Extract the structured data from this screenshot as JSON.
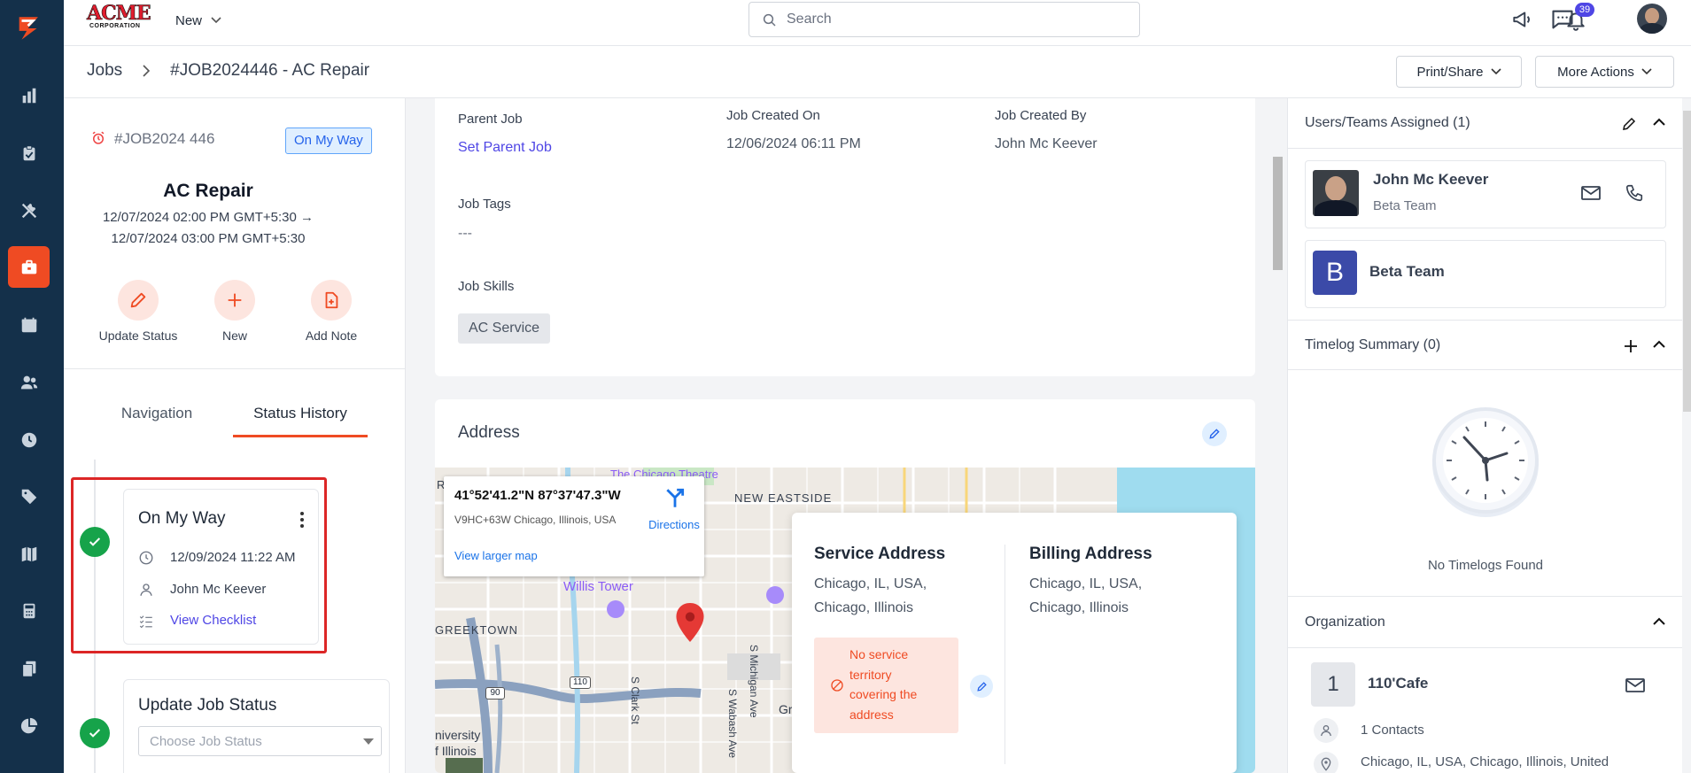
{
  "brand": {
    "logo_text": "ACME",
    "logo_sub": "CORPORATION",
    "accent": "#ef4b23",
    "rail_color": "#14304a"
  },
  "topbar": {
    "new_label": "New",
    "search_placeholder": "Search",
    "notification_count": "39"
  },
  "breadcrumb": {
    "root": "Jobs",
    "current": "#JOB2024446 - AC Repair"
  },
  "header_actions": {
    "print_share": "Print/Share",
    "more_actions": "More Actions"
  },
  "rail": [
    "logo-icon",
    "reports-icon",
    "clipboard-icon",
    "tools-icon",
    "jobs-icon",
    "calendar-icon",
    "users-icon",
    "clock-icon",
    "tag-icon",
    "map-icon",
    "calculator-icon",
    "documents-icon",
    "pie-chart-icon"
  ],
  "job": {
    "id": "#JOB2024 446",
    "status": "On My Way",
    "title": "AC Repair",
    "schedule_line1": "12/07/2024 02:00 PM GMT+5:30 →",
    "schedule_line2": "12/07/2024 03:00 PM GMT+5:30",
    "actions": [
      "Update Status",
      "New",
      "Add Note"
    ]
  },
  "left_tabs": {
    "navigation": "Navigation",
    "status_history": "Status History"
  },
  "history": {
    "status": "On My Way",
    "time": "12/09/2024 11:22 AM",
    "user": "John Mc Keever",
    "checklist_link": "View Checklist",
    "update_title": "Update Job Status",
    "update_placeholder": "Choose Job Status"
  },
  "details": {
    "parent_job_label": "Parent Job",
    "parent_job_link": "Set Parent Job",
    "created_on_label": "Job Created On",
    "created_on_value": "12/06/2024 06:11 PM",
    "created_by_label": "Job Created By",
    "created_by_value": "John Mc Keever",
    "tags_label": "Job Tags",
    "tags_value": "---",
    "skills_label": "Job Skills",
    "skill_chip": "AC Service"
  },
  "address": {
    "title": "Address",
    "map": {
      "coords": "41°52'41.2\"N 87°37'47.3\"W",
      "plus_code": "V9HC+63W Chicago, Illinois, USA",
      "directions": "Directions",
      "larger_map": "View larger map",
      "labels": {
        "theatre": "The Chicago Theatre",
        "eastside": "NEW EASTSIDE",
        "willis": "Willis Tower",
        "greektown": "GREEKTOWN",
        "university": "niversity",
        "illinois": "f Illinois",
        "clark": "S Clark St",
        "wabash": "S Wabash Ave",
        "michigan": "S Michigan Ave",
        "r": "R",
        "gr": "Gr",
        "i90": "90",
        "i110": "110"
      }
    },
    "service_title": "Service Address",
    "service_line1": "Chicago, IL, USA,",
    "service_line2": "Chicago, Illinois",
    "billing_title": "Billing Address",
    "billing_line1": "Chicago, IL, USA,",
    "billing_line2": "Chicago, Illinois",
    "territory_warning": [
      "No service",
      "territory",
      "covering the",
      "address"
    ]
  },
  "assigned": {
    "title": "Users/Teams Assigned (1)",
    "user_name": "John Mc Keever",
    "user_team": "Beta Team",
    "team_initial": "B",
    "team_name": "Beta Team"
  },
  "timelog": {
    "title": "Timelog Summary (0)",
    "empty": "No Timelogs Found"
  },
  "organization": {
    "title": "Organization",
    "initial": "1",
    "name": "110'Cafe",
    "contacts": "1 Contacts",
    "address": "Chicago, IL, USA, Chicago, Illinois, United"
  }
}
